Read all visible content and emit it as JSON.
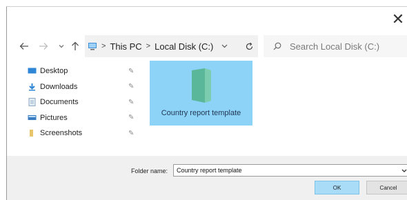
{
  "window": {
    "close_glyph": "✕"
  },
  "navbar": {
    "back_icon": "arrow-left-icon",
    "forward_icon": "arrow-right-icon",
    "recent_icon": "chevron-down-icon",
    "up_icon": "arrow-up-icon",
    "breadcrumbs": [
      "This PC",
      "Local Disk (C:)"
    ],
    "refresh_icon": "refresh-icon"
  },
  "search": {
    "placeholder": "Search Local Disk (C:)"
  },
  "sidebar": {
    "items": [
      {
        "label": "Desktop",
        "icon": "desktop-icon",
        "color": "#2f86d6"
      },
      {
        "label": "Downloads",
        "icon": "download-icon",
        "color": "#2f86d6"
      },
      {
        "label": "Documents",
        "icon": "documents-icon",
        "color": "#8aa6c2"
      },
      {
        "label": "Pictures",
        "icon": "pictures-icon",
        "color": "#3a7cc0"
      },
      {
        "label": "Screenshots",
        "icon": "folder-icon",
        "color": "#e8c56a"
      }
    ]
  },
  "content": {
    "items": [
      {
        "name": "Country report template",
        "icon": "folder-icon",
        "selected": true
      }
    ]
  },
  "footer": {
    "folder_name_label": "Folder name:",
    "folder_name_value": "Country report template",
    "ok_label": "OK",
    "cancel_label": "Cancel"
  },
  "colors": {
    "selection": "#8dd3f8",
    "ok_button": "#a9dcf7",
    "footer_bg": "#f0f0f0",
    "address_bg": "#f1f1f1"
  }
}
